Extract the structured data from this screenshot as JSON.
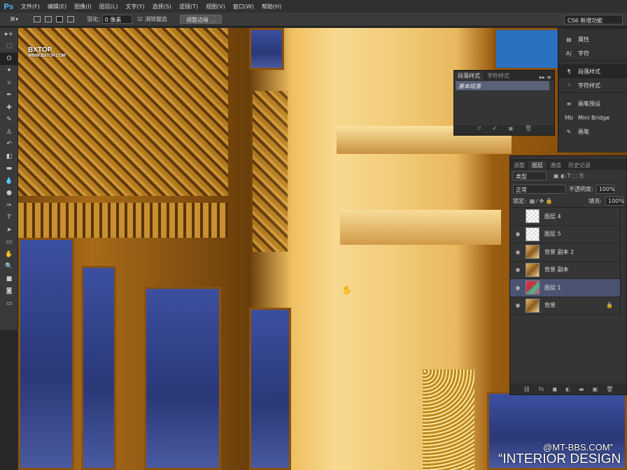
{
  "app": {
    "logo": "Ps"
  },
  "menu": [
    "文件(F)",
    "编辑(E)",
    "图像(I)",
    "图层(L)",
    "文字(Y)",
    "选择(S)",
    "滤镜(T)",
    "视图(V)",
    "窗口(W)",
    "帮助(H)"
  ],
  "options": {
    "feather_label": "羽化:",
    "feather_value": "0 像素",
    "antialias_label": "消除锯齿",
    "antialias_checked": true,
    "refine_edge": "调整边缘 ...",
    "workspace": "CS6 新增功能"
  },
  "tools": [
    "move",
    "marquee",
    "lasso",
    "magic-wand",
    "crop",
    "eyedropper",
    "healing",
    "brush",
    "clone-stamp",
    "history-brush",
    "eraser",
    "gradient",
    "blur",
    "dodge",
    "pen",
    "type",
    "path-select",
    "shape",
    "hand",
    "zoom",
    "colors",
    "quickmask",
    "screen-mode"
  ],
  "dock": {
    "items": [
      "属性",
      "字符",
      "段落样式",
      "字符样式",
      "画笔预设",
      "Mini Bridge",
      "画笔"
    ],
    "icons": [
      "▤",
      "A|",
      "¶",
      "ᴬ",
      "≡",
      "Mb",
      "✎"
    ]
  },
  "para_panel": {
    "tabs": [
      "段落样式",
      "字符样式"
    ],
    "items": [
      "基本段落"
    ]
  },
  "layers_panel": {
    "tabs": [
      "调整",
      "图层",
      "通道",
      "历史记录"
    ],
    "active_tab": 1,
    "filter": "类型",
    "blend_mode": "正常",
    "opacity_label": "不透明度:",
    "opacity": "100%",
    "lock_label": "锁定:",
    "fill_label": "填充:",
    "fill": "100%",
    "layers": [
      {
        "name": "图层 4",
        "visible": false,
        "thumb": "chk"
      },
      {
        "name": "图层 5",
        "visible": true,
        "thumb": "chk"
      },
      {
        "name": "背景 副本 2",
        "visible": true,
        "thumb": "gold"
      },
      {
        "name": "背景 副本",
        "visible": true,
        "thumb": "gold"
      },
      {
        "name": "图层 1",
        "visible": true,
        "thumb": "lay1",
        "selected": true
      },
      {
        "name": "背景",
        "visible": true,
        "thumb": "gold",
        "locked": true
      }
    ],
    "footer_icons": [
      "link",
      "fx",
      "mask",
      "adjustment",
      "folder",
      "new-layer",
      "trash"
    ]
  },
  "watermarks": {
    "logo_text": "BXTOP",
    "logo_url": "WWW.BXTOP.COM",
    "site": "@MT-BBS.COM”",
    "title": "“INTERIOR DESIGN"
  }
}
